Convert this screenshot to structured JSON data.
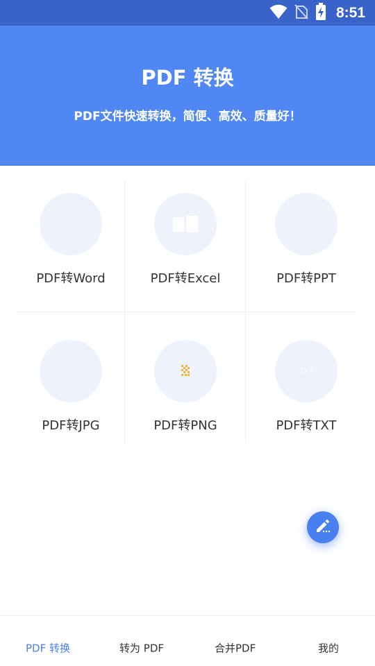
{
  "status_bar": {
    "time": "8:51",
    "icons": [
      "wifi-icon",
      "no-sim-icon",
      "battery-charging-icon"
    ]
  },
  "header": {
    "title": "PDF 转换",
    "subtitle": "PDF文件快速转换，简便、高效、质量好！",
    "background_color": "#5187f2"
  },
  "tools": [
    {
      "label": "PDF转Word",
      "icon": "word-icon"
    },
    {
      "label": "PDF转Excel",
      "icon": "excel-icon"
    },
    {
      "label": "PDF转PPT",
      "icon": "ppt-icon"
    },
    {
      "label": "PDF转JPG",
      "icon": "jpg-icon"
    },
    {
      "label": "PDF转PNG",
      "icon": "png-icon"
    },
    {
      "label": "PDF转TXT",
      "icon": "txt-icon",
      "icon_text": "TXT"
    }
  ],
  "fab": {
    "icon": "edit-icon",
    "color": "#4a7ff0"
  },
  "bottom_nav": {
    "active_color": "#4a7ff0",
    "items": [
      {
        "label": "PDF 转换",
        "active": true
      },
      {
        "label": "转为 PDF",
        "active": false
      },
      {
        "label": "合并PDF",
        "active": false
      },
      {
        "label": "我的",
        "active": false
      }
    ]
  }
}
